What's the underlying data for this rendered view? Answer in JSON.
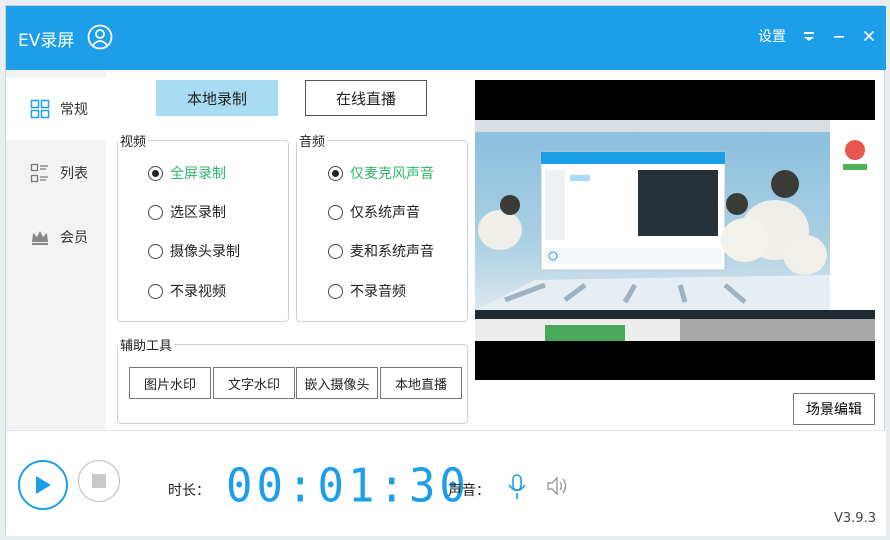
{
  "window": {
    "title": "EV录屏",
    "settings_label": "设置",
    "accent_color": "#1c9fe8",
    "selected_color": "#2fb86b"
  },
  "sidebar": {
    "items": [
      {
        "label": "常规",
        "icon": "grid-icon",
        "active": true
      },
      {
        "label": "列表",
        "icon": "list-icon",
        "active": false
      },
      {
        "label": "会员",
        "icon": "crown-icon",
        "active": false
      }
    ]
  },
  "tabs": {
    "local": "本地录制",
    "live": "在线直播"
  },
  "video": {
    "label": "视频",
    "options": [
      "全屏录制",
      "选区录制",
      "摄像头录制",
      "不录视频"
    ],
    "selected": "全屏录制"
  },
  "audio": {
    "label": "音频",
    "options": [
      "仅麦克风声音",
      "仅系统声音",
      "麦和系统声音",
      "不录音频"
    ],
    "selected": "仅麦克风声音"
  },
  "tools": {
    "label": "辅助工具",
    "buttons": [
      "图片水印",
      "文字水印",
      "嵌入摄像头",
      "本地直播"
    ]
  },
  "preview": {
    "scene_button": "场景编辑"
  },
  "footer": {
    "duration_label": "时长：",
    "timer": "00:01:30",
    "volume_label": "声音：",
    "version": "V3.9.3"
  }
}
